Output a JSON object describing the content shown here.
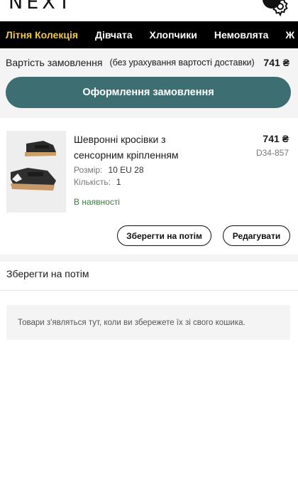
{
  "header": {
    "logo": "NEXT",
    "icons": [
      "settings-icon"
    ]
  },
  "nav": {
    "items": [
      {
        "label": "Літня Колекція",
        "active": true
      },
      {
        "label": "Дівчата"
      },
      {
        "label": "Хлопчики"
      },
      {
        "label": "Немовлята"
      },
      {
        "label": "Ж"
      }
    ],
    "active_color": "#f2c744"
  },
  "summary": {
    "label": "Вартість замовлення",
    "note": "(без урахування вартості доставки)",
    "total": "741 ₴",
    "checkout_label": "Оформлення замовлення",
    "accent": "#3d6f72"
  },
  "item": {
    "title": "Шевронні кросівки з сенсорним кріпленням",
    "price": "741 ₴",
    "code": "D34-857",
    "size_label": "Розмір:",
    "size_value": "10 EU 28",
    "qty_label": "Кількість:",
    "qty_value": "1",
    "stock": "В наявності",
    "save_label": "Зберегти на потім",
    "edit_label": "Редагувати"
  },
  "saved": {
    "title": "Зберегти на потім",
    "empty_message": "Товари з'являться тут, коли ви збережете їх зі свого кошика."
  }
}
